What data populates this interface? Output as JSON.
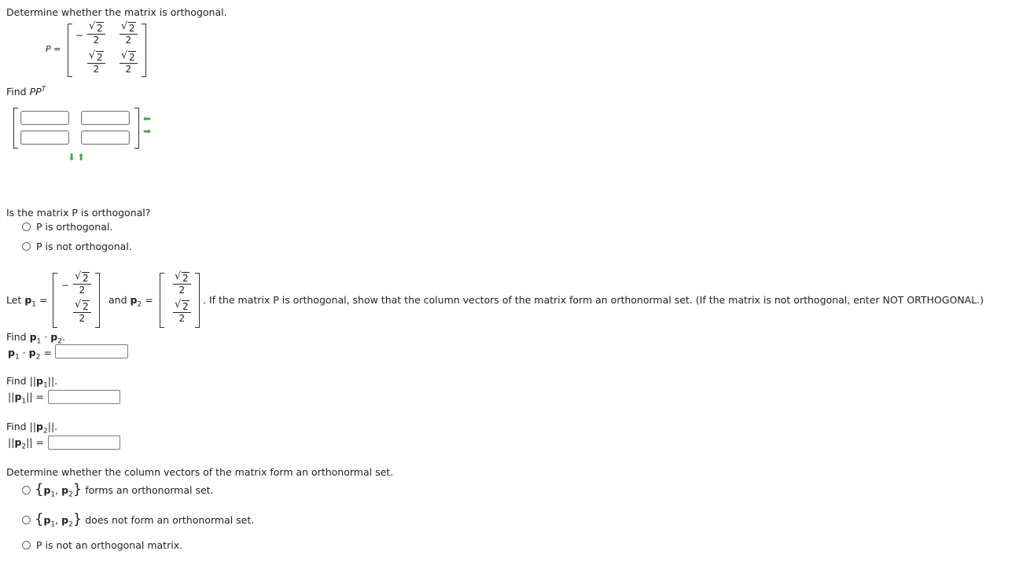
{
  "q1": {
    "prompt": "Determine whether the matrix is orthogonal.",
    "p_label": "P =",
    "matrix": {
      "neg": "−",
      "radicand": "2",
      "den": "2"
    },
    "find_label": "Find",
    "find_expr_base": "PP",
    "find_expr_sup": "T"
  },
  "q2": {
    "question": "Is the matrix P is orthogonal?",
    "option1": "P is orthogonal.",
    "option2": "P is not orthogonal."
  },
  "q3": {
    "let_label": "Let",
    "p1_label": "p",
    "sub1": "1",
    "sub2": "2",
    "equals": "=",
    "and_label": "and",
    "instruction": ". If the matrix P is orthogonal, show that the column vectors of the matrix form an orthonormal set. (If the matrix is not orthogonal, enter NOT ORTHOGONAL.)",
    "find_dot_label": "Find",
    "dot": "·",
    "find_norm_label": "Find",
    "norm_bars": "||",
    "period": "."
  },
  "q4": {
    "prompt": "Determine whether the column vectors of the matrix form an orthonormal set.",
    "option1_tail": "forms an orthonormal set.",
    "option2_tail": "does not form an orthonormal set.",
    "option3": "P is not an orthogonal matrix.",
    "comma": ","
  },
  "icons": {
    "arrow_left": "⬅",
    "arrow_right": "➡",
    "arrow_down": "⬇",
    "arrow_up": "⬆"
  },
  "colors": {
    "arrow": "#4aa24a"
  }
}
